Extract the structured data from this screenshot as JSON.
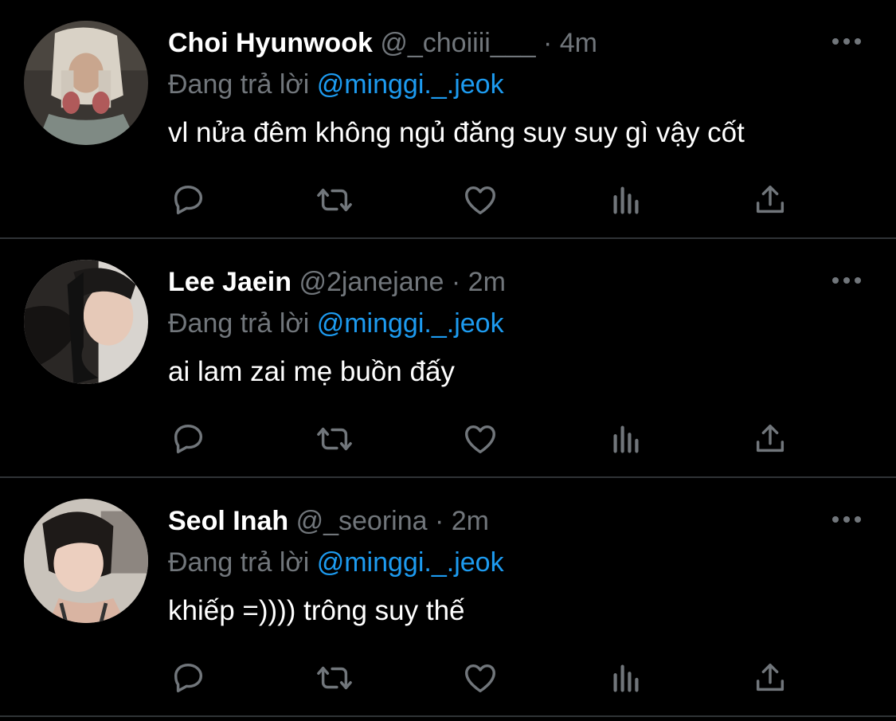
{
  "reply_prefix": "Đang trả lời",
  "separator": "·",
  "tweets": [
    {
      "name": "Choi Hyunwook",
      "handle": "@_choiiii___",
      "time": "4m",
      "reply_to": "@minggi._.jeok",
      "text": "vl nửa đêm không ngủ đăng suy suy gì vậy cốt"
    },
    {
      "name": "Lee Jaein",
      "handle": "@2janejane",
      "time": "2m",
      "reply_to": "@minggi._.jeok",
      "text": "ai lam zai mẹ buồn đấy"
    },
    {
      "name": "Seol Inah",
      "handle": "@_seorina",
      "time": "2m",
      "reply_to": "@minggi._.jeok",
      "text": "khiếp =)))) trông suy thế"
    }
  ],
  "icons": [
    "reply-icon",
    "retweet-icon",
    "like-icon",
    "analytics-icon",
    "share-icon",
    "more-icon"
  ],
  "colors": {
    "background": "#000000",
    "muted": "#71767b",
    "accent": "#1d9bf0",
    "divider": "#2f3336"
  }
}
